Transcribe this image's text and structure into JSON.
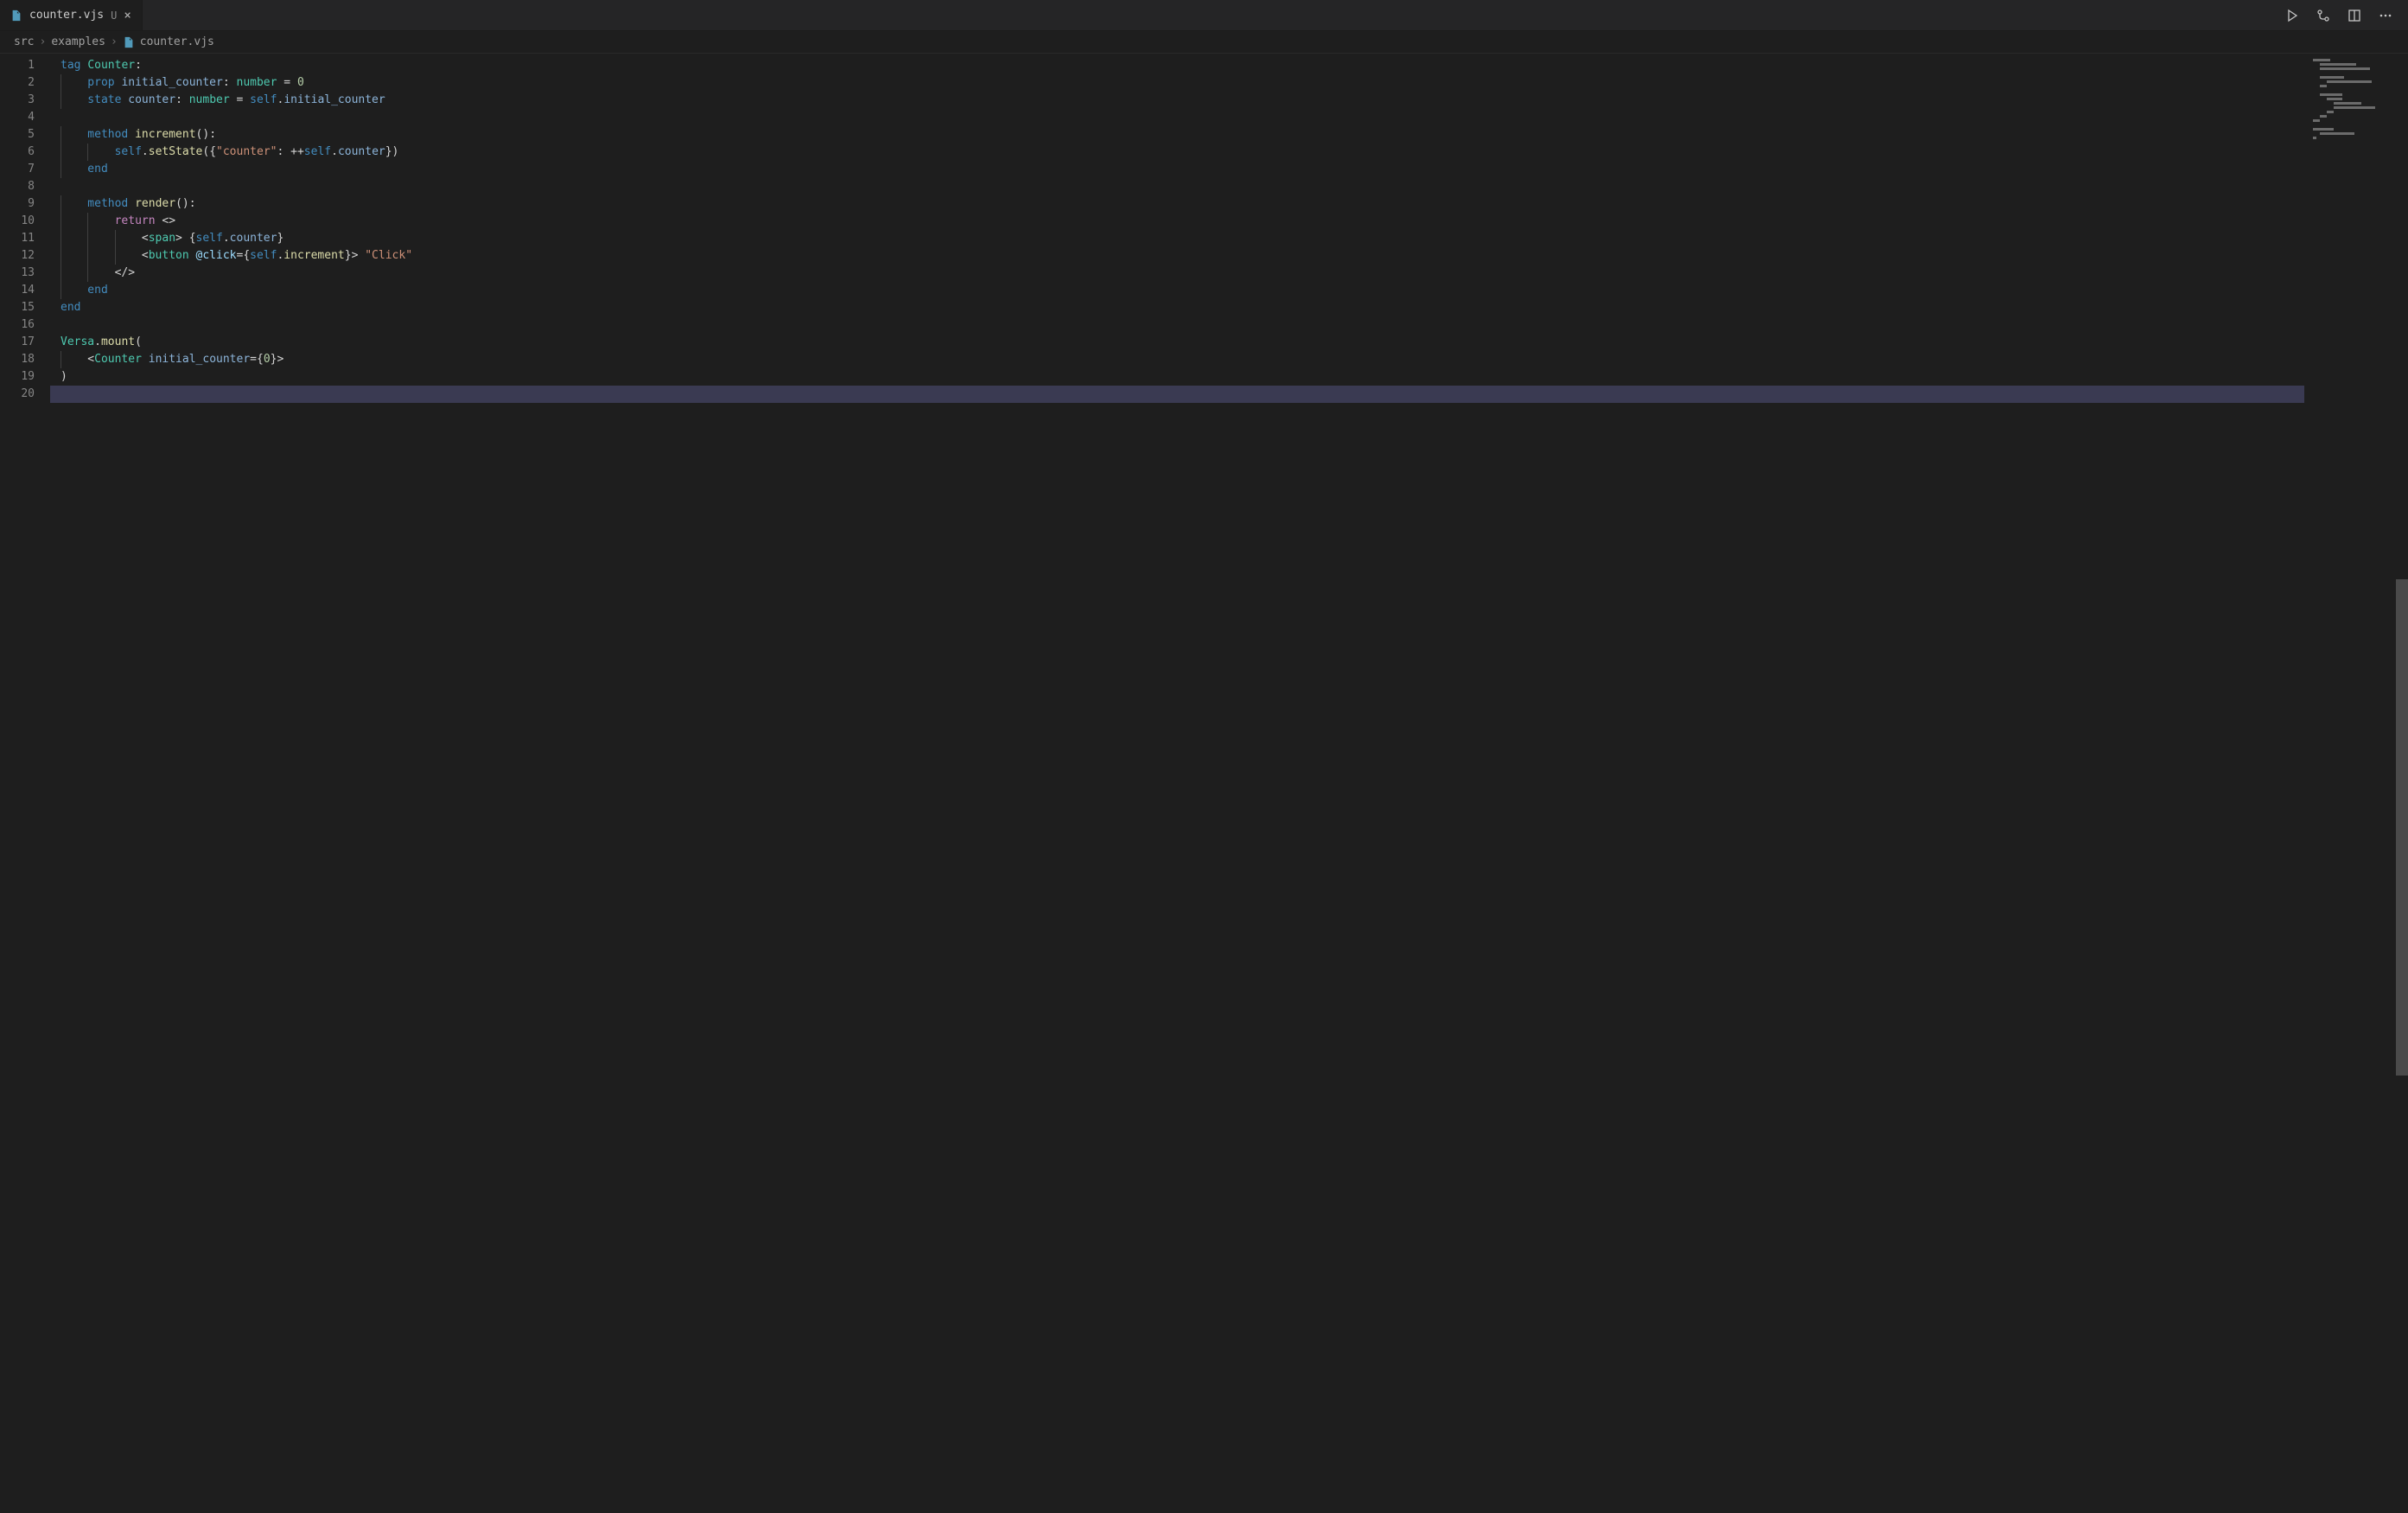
{
  "tab": {
    "filename": "counter.vjs",
    "modified_indicator": "U",
    "close_glyph": "×"
  },
  "breadcrumbs": {
    "parts": [
      "src",
      "examples",
      "counter.vjs"
    ],
    "separator": "›"
  },
  "editor": {
    "line_count": 20,
    "cursor_line": 20,
    "lines": [
      {
        "n": 1,
        "indent": 0,
        "segments": [
          {
            "t": "tag ",
            "c": "kw"
          },
          {
            "t": "Counter",
            "c": "typ"
          },
          {
            "t": ":",
            "c": "pun"
          }
        ]
      },
      {
        "n": 2,
        "indent": 1,
        "segments": [
          {
            "t": "prop ",
            "c": "kw"
          },
          {
            "t": "initial_counter",
            "c": "idm"
          },
          {
            "t": ": ",
            "c": "pun"
          },
          {
            "t": "number",
            "c": "typ"
          },
          {
            "t": " = ",
            "c": "pun"
          },
          {
            "t": "0",
            "c": "num"
          }
        ]
      },
      {
        "n": 3,
        "indent": 1,
        "segments": [
          {
            "t": "state ",
            "c": "kw"
          },
          {
            "t": "counter",
            "c": "idm"
          },
          {
            "t": ": ",
            "c": "pun"
          },
          {
            "t": "number",
            "c": "typ"
          },
          {
            "t": " = ",
            "c": "pun"
          },
          {
            "t": "self",
            "c": "self"
          },
          {
            "t": ".",
            "c": "pun"
          },
          {
            "t": "initial_counter",
            "c": "idm"
          }
        ]
      },
      {
        "n": 4,
        "indent": 0,
        "segments": []
      },
      {
        "n": 5,
        "indent": 1,
        "segments": [
          {
            "t": "method ",
            "c": "kw"
          },
          {
            "t": "increment",
            "c": "fn"
          },
          {
            "t": "():",
            "c": "pun"
          }
        ]
      },
      {
        "n": 6,
        "indent": 2,
        "segments": [
          {
            "t": "self",
            "c": "self"
          },
          {
            "t": ".",
            "c": "pun"
          },
          {
            "t": "setState",
            "c": "fn"
          },
          {
            "t": "({",
            "c": "pun"
          },
          {
            "t": "\"counter\"",
            "c": "str"
          },
          {
            "t": ": ++",
            "c": "pun"
          },
          {
            "t": "self",
            "c": "self"
          },
          {
            "t": ".",
            "c": "pun"
          },
          {
            "t": "counter",
            "c": "idm"
          },
          {
            "t": "})",
            "c": "pun"
          }
        ]
      },
      {
        "n": 7,
        "indent": 1,
        "segments": [
          {
            "t": "end",
            "c": "kw"
          }
        ]
      },
      {
        "n": 8,
        "indent": 0,
        "segments": []
      },
      {
        "n": 9,
        "indent": 1,
        "segments": [
          {
            "t": "method ",
            "c": "kw"
          },
          {
            "t": "render",
            "c": "fn"
          },
          {
            "t": "():",
            "c": "pun"
          }
        ]
      },
      {
        "n": 10,
        "indent": 2,
        "segments": [
          {
            "t": "return ",
            "c": "imp"
          },
          {
            "t": "<>",
            "c": "pun"
          }
        ]
      },
      {
        "n": 11,
        "indent": 3,
        "segments": [
          {
            "t": "<",
            "c": "pun"
          },
          {
            "t": "span",
            "c": "tagc"
          },
          {
            "t": "> {",
            "c": "pun"
          },
          {
            "t": "self",
            "c": "self"
          },
          {
            "t": ".",
            "c": "pun"
          },
          {
            "t": "counter",
            "c": "idm"
          },
          {
            "t": "}",
            "c": "pun"
          }
        ]
      },
      {
        "n": 12,
        "indent": 3,
        "segments": [
          {
            "t": "<",
            "c": "pun"
          },
          {
            "t": "button",
            "c": "tagc"
          },
          {
            "t": " ",
            "c": "pun"
          },
          {
            "t": "@click",
            "c": "deco"
          },
          {
            "t": "={",
            "c": "pun"
          },
          {
            "t": "self",
            "c": "self"
          },
          {
            "t": ".",
            "c": "pun"
          },
          {
            "t": "increment",
            "c": "fn"
          },
          {
            "t": "}> ",
            "c": "pun"
          },
          {
            "t": "\"Click\"",
            "c": "str"
          }
        ]
      },
      {
        "n": 13,
        "indent": 2,
        "segments": [
          {
            "t": "</>",
            "c": "pun"
          }
        ]
      },
      {
        "n": 14,
        "indent": 1,
        "segments": [
          {
            "t": "end",
            "c": "kw"
          }
        ]
      },
      {
        "n": 15,
        "indent": 0,
        "segments": [
          {
            "t": "end",
            "c": "kw"
          }
        ]
      },
      {
        "n": 16,
        "indent": 0,
        "segments": []
      },
      {
        "n": 17,
        "indent": 0,
        "segments": [
          {
            "t": "Versa",
            "c": "typ"
          },
          {
            "t": ".",
            "c": "pun"
          },
          {
            "t": "mount",
            "c": "fn"
          },
          {
            "t": "(",
            "c": "pun"
          }
        ]
      },
      {
        "n": 18,
        "indent": 1,
        "segments": [
          {
            "t": "<",
            "c": "pun"
          },
          {
            "t": "Counter",
            "c": "typ"
          },
          {
            "t": " ",
            "c": "pun"
          },
          {
            "t": "initial_counter",
            "c": "idm"
          },
          {
            "t": "={",
            "c": "pun"
          },
          {
            "t": "0",
            "c": "num"
          },
          {
            "t": "}>",
            "c": "pun"
          }
        ]
      },
      {
        "n": 19,
        "indent": 0,
        "segments": [
          {
            "t": ")",
            "c": "pun"
          }
        ]
      },
      {
        "n": 20,
        "indent": 0,
        "segments": []
      }
    ]
  },
  "minimap": {
    "thumb_top_pct": 36,
    "thumb_height_pct": 34,
    "rows": [
      [
        [
          0,
          20
        ]
      ],
      [
        [
          8,
          42
        ]
      ],
      [
        [
          8,
          58
        ]
      ],
      [],
      [
        [
          8,
          28
        ]
      ],
      [
        [
          16,
          52
        ]
      ],
      [
        [
          8,
          8
        ]
      ],
      [],
      [
        [
          8,
          26
        ]
      ],
      [
        [
          16,
          18
        ]
      ],
      [
        [
          24,
          32
        ]
      ],
      [
        [
          24,
          48
        ]
      ],
      [
        [
          16,
          8
        ]
      ],
      [
        [
          8,
          8
        ]
      ],
      [
        [
          0,
          8
        ]
      ],
      [],
      [
        [
          0,
          24
        ]
      ],
      [
        [
          8,
          40
        ]
      ],
      [
        [
          0,
          4
        ]
      ]
    ]
  }
}
